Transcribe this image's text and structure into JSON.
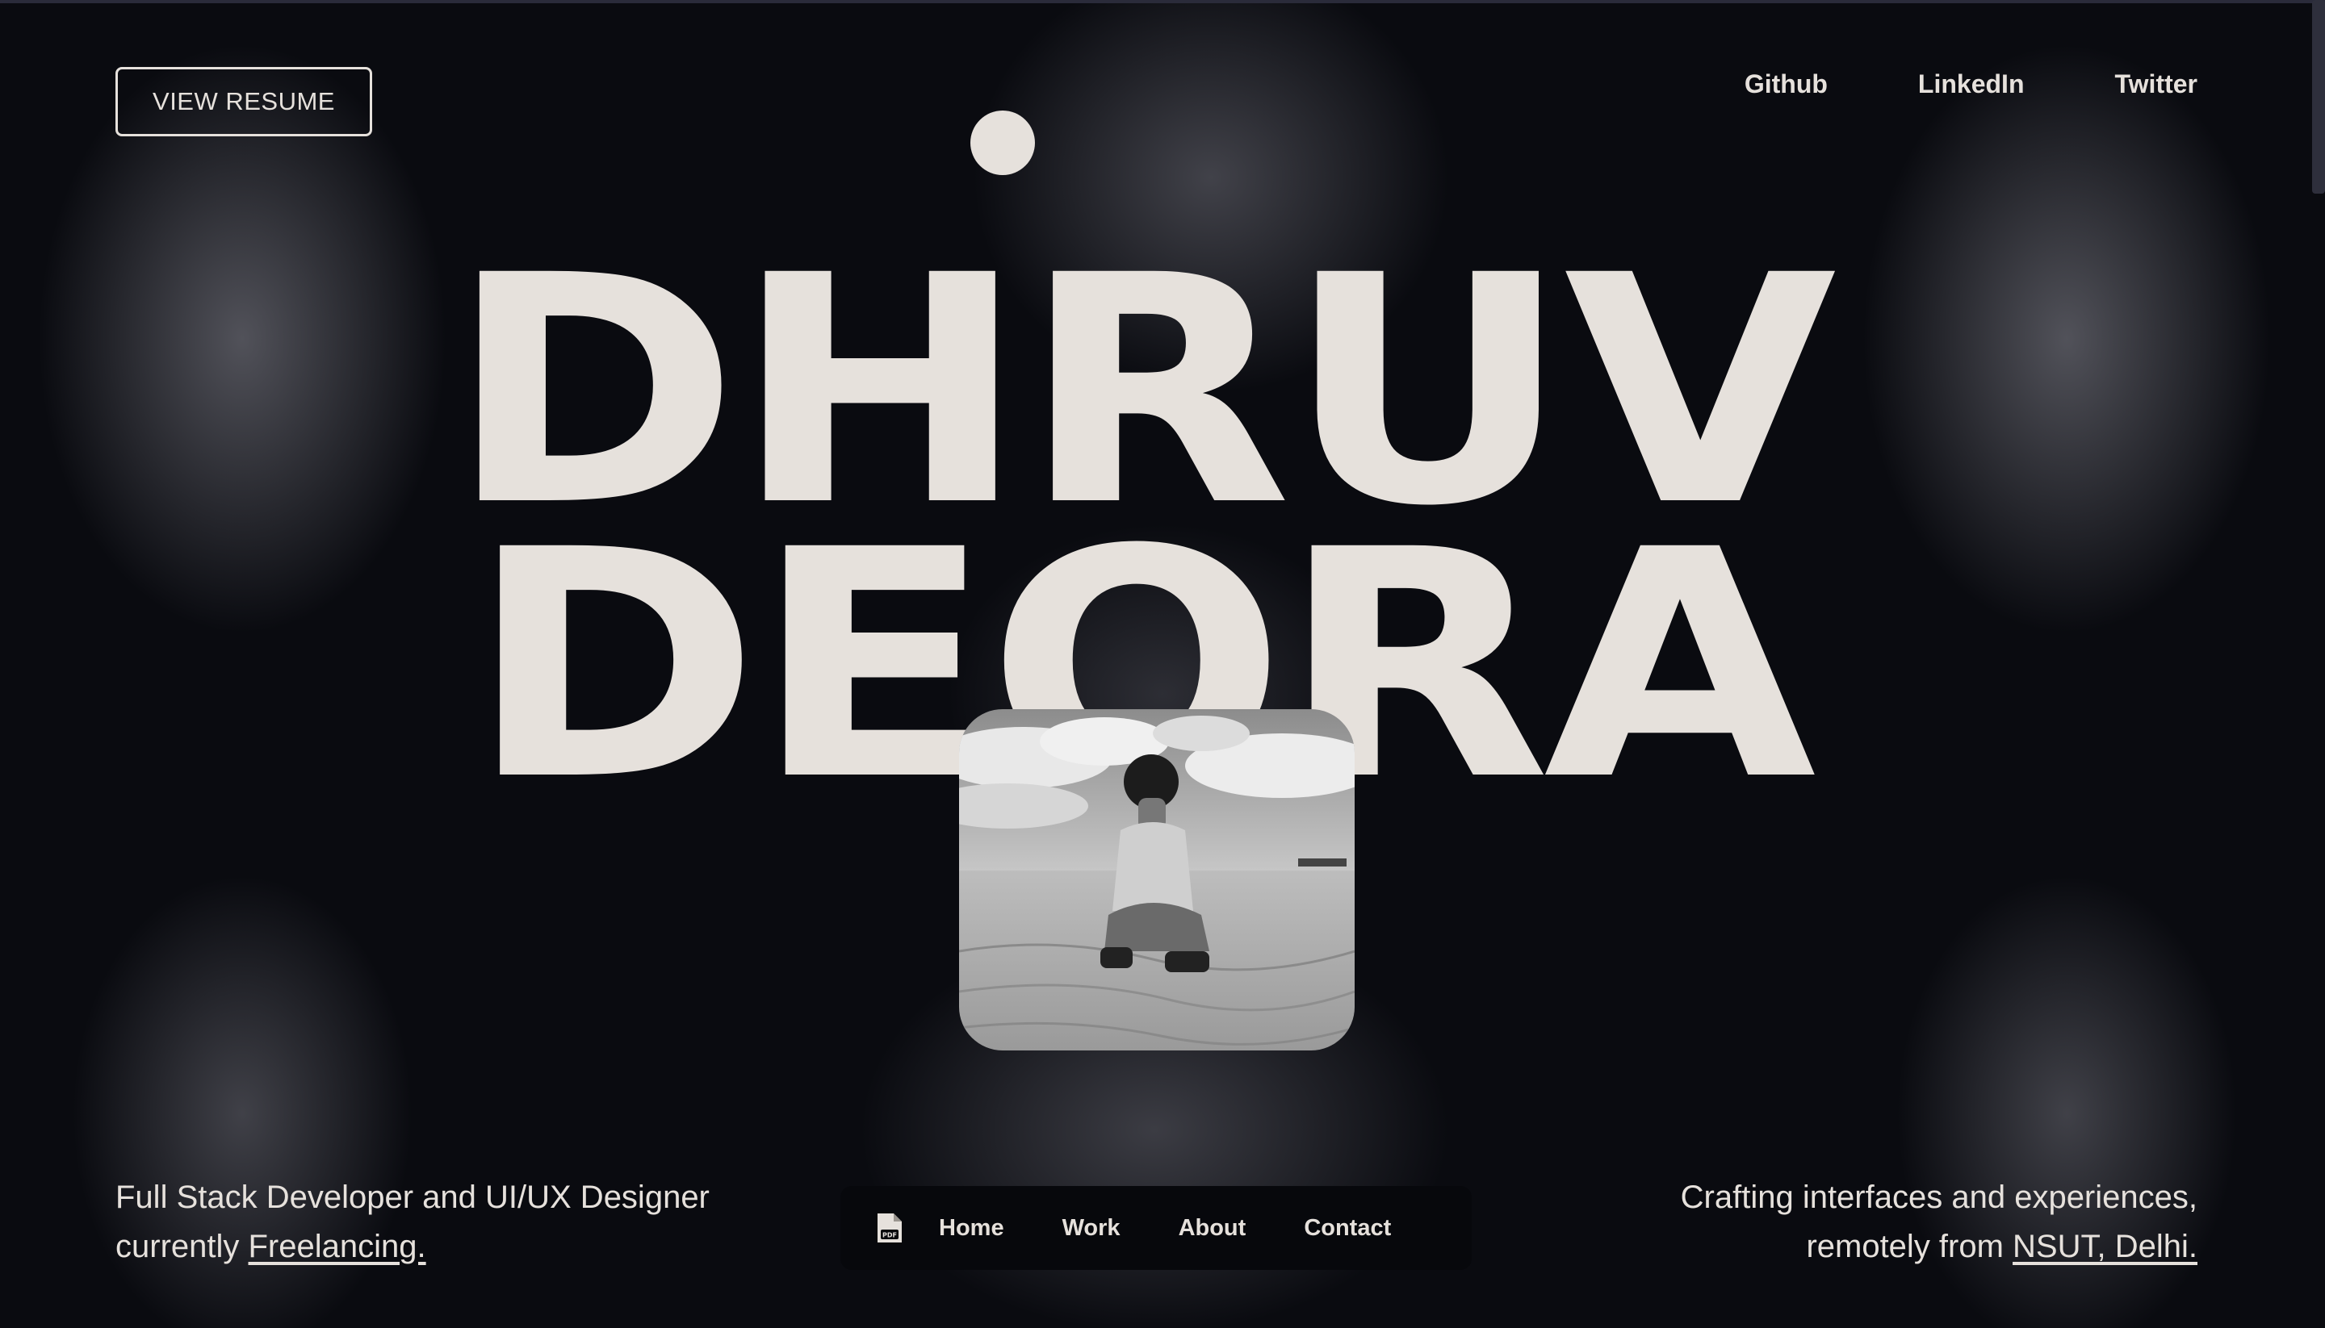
{
  "header": {
    "resume_label": "VIEW RESUME",
    "links": [
      "Github",
      "LinkedIn",
      "Twitter"
    ]
  },
  "hero": {
    "first_name": "DHRUV",
    "last_name": "DEORA"
  },
  "photo": {
    "alt": "Black and white portrait of a person crouching on a sand dune"
  },
  "intro_left": {
    "line1": "Full Stack Developer and UI/UX Designer",
    "prefix": "currently ",
    "link": "Freelancing."
  },
  "intro_right": {
    "line1": "Crafting interfaces and experiences,",
    "prefix": "remotely from ",
    "link": "NSUT, Delhi."
  },
  "dock": {
    "pdf_icon": "pdf-file-icon",
    "items": [
      "Home",
      "Work",
      "About",
      "Contact"
    ]
  },
  "colors": {
    "background": "#0a0b10",
    "text": "#e6e1dc",
    "dock": "#07080c"
  }
}
